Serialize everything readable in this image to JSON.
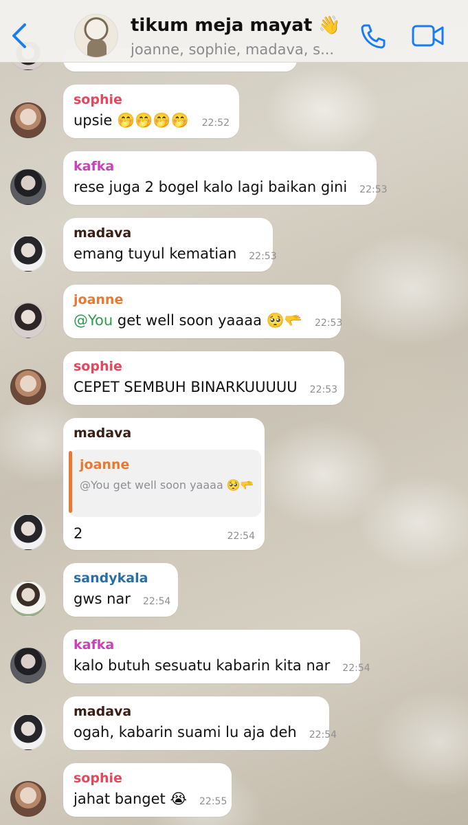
{
  "header": {
    "back_label": "",
    "title": "tikum meja mayat 👋",
    "subtitle": "joanne, sophie, madava, s..."
  },
  "messages": [
    {
      "sender": "sophie",
      "text": "upsie 🤭🤭🤭🤭",
      "time": "22:52"
    },
    {
      "sender": "kafka",
      "text": "rese juga 2 bogel kalo lagi baikan gini",
      "time": "22:53"
    },
    {
      "sender": "madava",
      "text": "emang tuyul kematian",
      "time": "22:53"
    },
    {
      "sender": "joanne",
      "mention": "@You",
      "text": " get well soon yaaaa 🥺🫳",
      "time": "22:53"
    },
    {
      "sender": "sophie",
      "text": "CEPET SEMBUH BINARKUUUUU",
      "time": "22:53"
    },
    {
      "sender": "madava",
      "reply_to": {
        "sender": "joanne",
        "text": "@You get well soon yaaaa 🥺🫳"
      },
      "text": "2",
      "time": "22:54"
    },
    {
      "sender": "sandykala",
      "text": "gws nar",
      "time": "22:54"
    },
    {
      "sender": "kafka",
      "text": "kalo butuh sesuatu kabarin kita nar",
      "time": "22:54"
    },
    {
      "sender": "madava",
      "text": "ogah, kabarin suami lu aja deh",
      "time": "22:54"
    },
    {
      "sender": "sophie",
      "text": "jahat banget 😭",
      "time": "22:55"
    }
  ],
  "colors": {
    "sophie": "#e5485c",
    "kafka": "#c940b8",
    "madava": "#3b1d14",
    "joanne": "#e67a35",
    "sandykala": "#2a6ea6",
    "mention": "#2b9d4c",
    "ios_blue": "#1a7cf4"
  },
  "icons": {
    "back": "chevron-left-icon",
    "call": "phone-icon",
    "video": "video-camera-icon"
  }
}
